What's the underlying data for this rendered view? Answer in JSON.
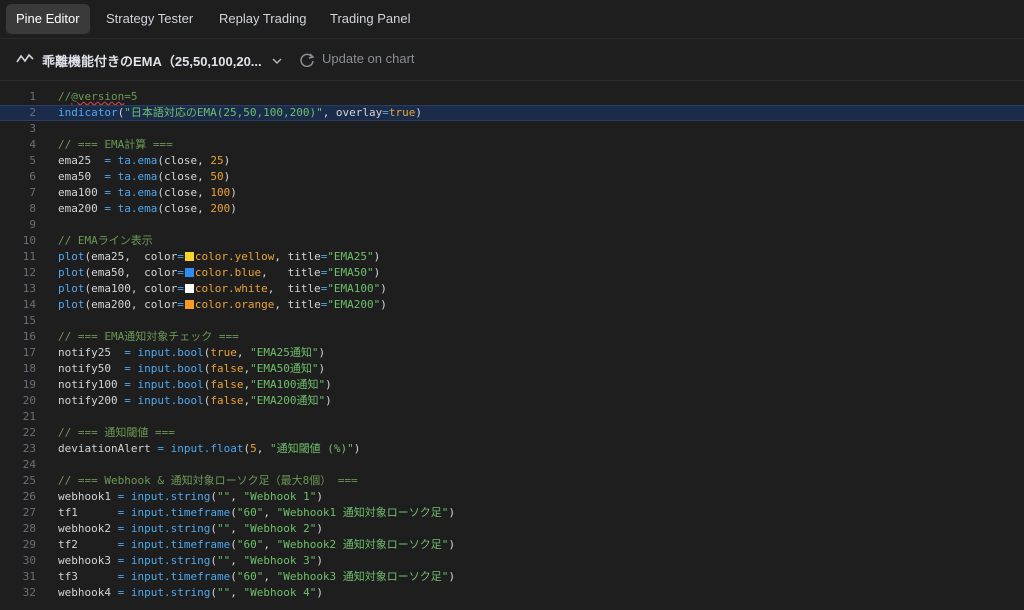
{
  "tabs": [
    {
      "label": "Pine Editor",
      "active": true
    },
    {
      "label": "Strategy Tester",
      "active": false
    },
    {
      "label": "Replay Trading",
      "active": false
    },
    {
      "label": "Trading Panel",
      "active": false
    }
  ],
  "toolbar": {
    "script_name": "乖離機能付きのEMA（25,50,100,20...",
    "update_label": "Update on chart"
  },
  "editor": {
    "current_line": 2,
    "lines": [
      {
        "n": "1",
        "t": "//@version=5"
      },
      {
        "n": "2",
        "t": "indicator(\"日本語対応のEMA(25,50,100,200)\", overlay=true)"
      },
      {
        "n": "3",
        "t": ""
      },
      {
        "n": "4",
        "t": "// === EMA計算 ==="
      },
      {
        "n": "5",
        "t": "ema25  = ta.ema(close, 25)"
      },
      {
        "n": "6",
        "t": "ema50  = ta.ema(close, 50)"
      },
      {
        "n": "7",
        "t": "ema100 = ta.ema(close, 100)"
      },
      {
        "n": "8",
        "t": "ema200 = ta.ema(close, 200)"
      },
      {
        "n": "9",
        "t": ""
      },
      {
        "n": "10",
        "t": "// EMAライン表示"
      },
      {
        "n": "11",
        "t": "plot(ema25,  color=color.yellow, title=\"EMA25\")"
      },
      {
        "n": "12",
        "t": "plot(ema50,  color=color.blue,   title=\"EMA50\")"
      },
      {
        "n": "13",
        "t": "plot(ema100, color=color.white,  title=\"EMA100\")"
      },
      {
        "n": "14",
        "t": "plot(ema200, color=color.orange, title=\"EMA200\")"
      },
      {
        "n": "15",
        "t": ""
      },
      {
        "n": "16",
        "t": "// === EMA通知対象チェック ==="
      },
      {
        "n": "17",
        "t": "notify25  = input.bool(true, \"EMA25通知\")"
      },
      {
        "n": "18",
        "t": "notify50  = input.bool(false,\"EMA50通知\")"
      },
      {
        "n": "19",
        "t": "notify100 = input.bool(false,\"EMA100通知\")"
      },
      {
        "n": "20",
        "t": "notify200 = input.bool(false,\"EMA200通知\")"
      },
      {
        "n": "21",
        "t": ""
      },
      {
        "n": "22",
        "t": "// === 通知閾値 ==="
      },
      {
        "n": "23",
        "t": "deviationAlert = input.float(5, \"通知閾値 (%)\")"
      },
      {
        "n": "24",
        "t": ""
      },
      {
        "n": "25",
        "t": "// === Webhook & 通知対象ローソク足（最大8個） ==="
      },
      {
        "n": "26",
        "t": "webhook1 = input.string(\"\", \"Webhook 1\")"
      },
      {
        "n": "27",
        "t": "tf1      = input.timeframe(\"60\", \"Webhook1 通知対象ローソク足\")"
      },
      {
        "n": "28",
        "t": "webhook2 = input.string(\"\", \"Webhook 2\")"
      },
      {
        "n": "29",
        "t": "tf2      = input.timeframe(\"60\", \"Webhook2 通知対象ローソク足\")"
      },
      {
        "n": "30",
        "t": "webhook3 = input.string(\"\", \"Webhook 3\")"
      },
      {
        "n": "31",
        "t": "tf3      = input.timeframe(\"60\", \"Webhook3 通知対象ローソク足\")"
      },
      {
        "n": "32",
        "t": "webhook4 = input.string(\"\", \"Webhook 4\")"
      }
    ]
  },
  "colors": {
    "yellow": "#f5d52a",
    "blue": "#2f8cf0",
    "white": "#ffffff",
    "orange": "#f59a23",
    "current_line_bg": "#1b2b4a"
  },
  "icons": {
    "script_icon": "line-chart-icon",
    "dropdown": "chevron-down-icon",
    "update": "refresh-icon"
  }
}
